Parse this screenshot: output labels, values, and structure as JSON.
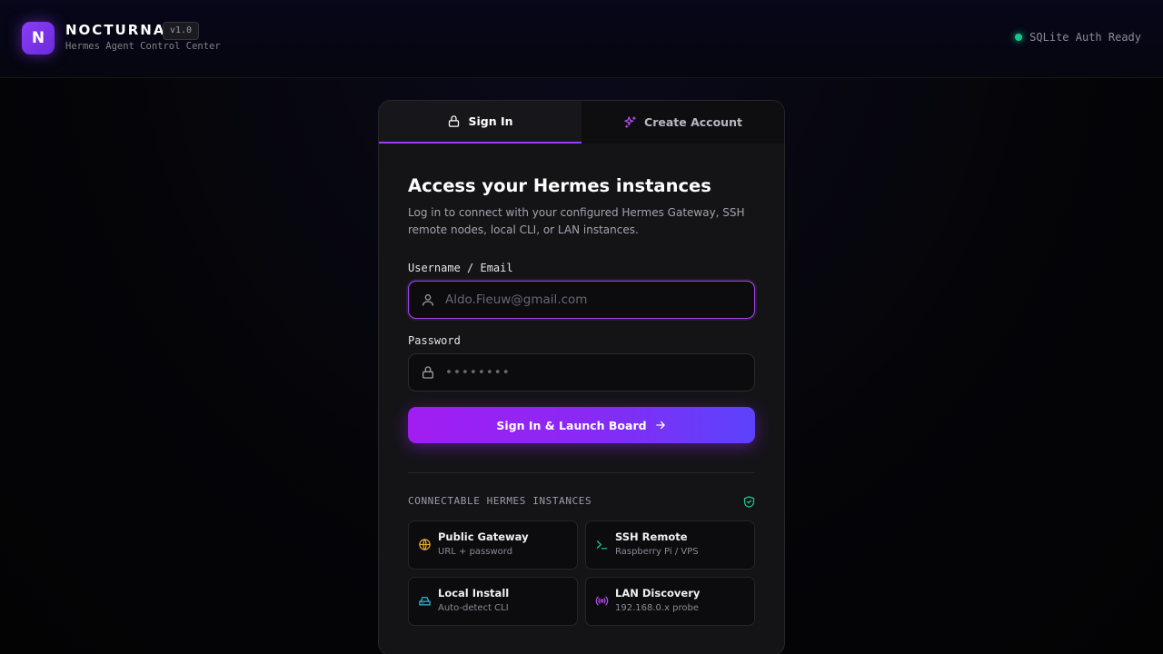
{
  "header": {
    "logo_letter": "N",
    "brand": "NOCTURNA",
    "version": "v1.0",
    "subtitle": "Hermes Agent Control Center",
    "status": {
      "text": "SQLite Auth Ready",
      "color": "#12c98a"
    }
  },
  "tabs": [
    {
      "label": "Sign In",
      "icon": "lock-icon",
      "active": true
    },
    {
      "label": "Create Account",
      "icon": "sparkles-icon",
      "active": false
    }
  ],
  "form": {
    "heading": "Access your Hermes instances",
    "description": "Log in to connect with your configured Hermes Gateway, SSH remote nodes, local CLI, or LAN instances.",
    "username": {
      "label": "Username / Email",
      "placeholder": "Aldo.Fieuw@gmail.com",
      "value": "",
      "icon": "user-icon"
    },
    "password": {
      "label": "Password",
      "placeholder": "••••••••",
      "value": "",
      "icon": "lock-icon"
    },
    "submit_label": "Sign In & Launch Board"
  },
  "instances": {
    "title": "CONNECTABLE HERMES INSTANCES",
    "items": [
      {
        "title": "Public Gateway",
        "subtitle": "URL + password",
        "icon": "globe-icon",
        "color": "#e3a72f"
      },
      {
        "title": "SSH Remote",
        "subtitle": "Raspberry Pi / VPS",
        "icon": "terminal-icon",
        "color": "#12c98a"
      },
      {
        "title": "Local Install",
        "subtitle": "Auto-detect CLI",
        "icon": "hard-drive-icon",
        "color": "#2fb8d6"
      },
      {
        "title": "LAN Discovery",
        "subtitle": "192.168.0.x probe",
        "icon": "broadcast-icon",
        "color": "#b04cf0"
      }
    ]
  },
  "colors": {
    "accent": "#9b3df5",
    "accent_end": "#5c43fb"
  }
}
